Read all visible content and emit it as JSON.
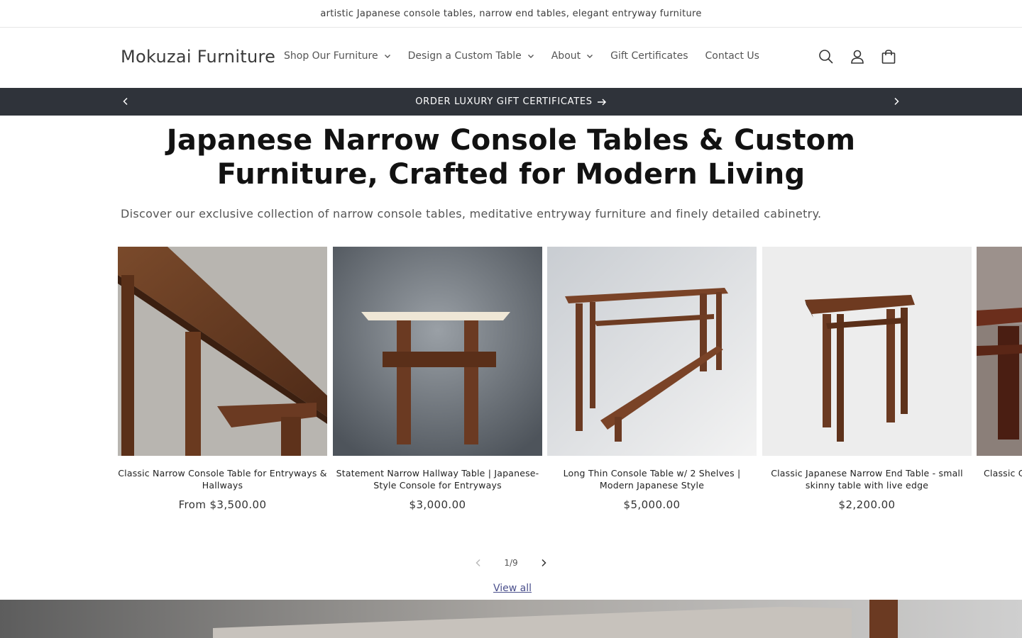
{
  "announcement": "artistic Japanese console tables, narrow end tables, elegant entryway furniture",
  "header": {
    "logo": "Mokuzai Furniture",
    "nav": [
      {
        "label": "Shop Our Furniture",
        "dropdown": true
      },
      {
        "label": "Design a Custom Table",
        "dropdown": true
      },
      {
        "label": "About",
        "dropdown": true
      },
      {
        "label": "Gift Certificates",
        "dropdown": false
      },
      {
        "label": "Contact Us",
        "dropdown": false
      }
    ],
    "icons": [
      "search-icon",
      "account-icon",
      "cart-icon"
    ]
  },
  "promo": {
    "text": "ORDER LUXURY GIFT CERTIFICATES",
    "bg": "#2f333a"
  },
  "hero": {
    "title": "Japanese Narrow Console Tables & Custom Furniture, Crafted for Modern Living",
    "description": "Discover our exclusive collection of narrow console tables, meditative entryway furniture and finely detailed cabinetry."
  },
  "products": [
    {
      "title": "Classic Narrow Console Table for Entryways & Hallways",
      "price": "From $3,500.00"
    },
    {
      "title": "Statement Narrow Hallway Table | Japanese-Style Console for Entryways",
      "price": "$3,000.00"
    },
    {
      "title": "Long Thin Console Table w/ 2 Shelves | Modern Japanese Style",
      "price": "$5,000.00"
    },
    {
      "title": "Classic Japanese Narrow End Table - small skinny table with live edge",
      "price": "$2,200.00"
    },
    {
      "title": "Classic Co",
      "price": ""
    }
  ],
  "pager": {
    "current": "1",
    "separator": "/",
    "total": "9"
  },
  "view_all": "View all",
  "colors": {
    "accent_link": "#4a4f8c",
    "wood": "#6b3a22"
  }
}
